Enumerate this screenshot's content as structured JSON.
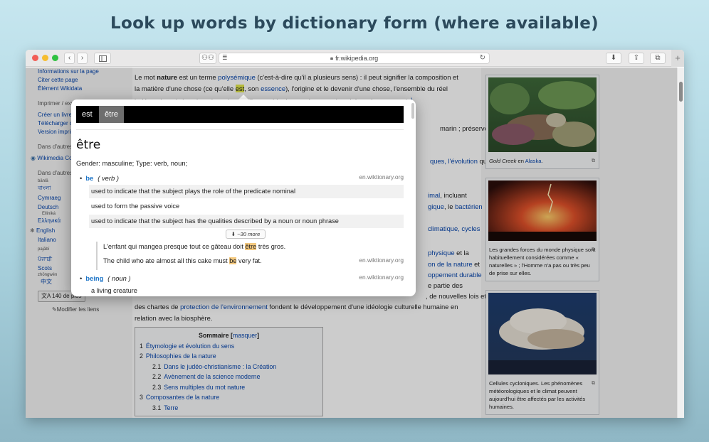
{
  "headline": "Look up words by dictionary form (where available)",
  "browser": {
    "url": "fr.wikipedia.org",
    "new_tab_symbol": "+"
  },
  "sidebar": {
    "items": [
      {
        "kind": "link",
        "text": "Informations sur la page"
      },
      {
        "kind": "link",
        "text": "Citer cette page"
      },
      {
        "kind": "link",
        "text": "Élément Wikidata"
      },
      {
        "kind": "head",
        "text": "Imprimer / exporter"
      },
      {
        "kind": "link",
        "text": "Créer un livre"
      },
      {
        "kind": "link",
        "text": "Télécharger comme PDF"
      },
      {
        "kind": "link",
        "text": "Version imprimable"
      },
      {
        "kind": "head",
        "text": "Dans d'autres projets"
      },
      {
        "kind": "link",
        "text": "Wikimedia Commons"
      },
      {
        "kind": "head",
        "text": "Dans d'autres langues"
      }
    ],
    "langs": [
      {
        "small": "bānlā",
        "text": "বাংলা"
      },
      {
        "small": "",
        "text": "Cymraeg"
      },
      {
        "small": "",
        "text": "Deutsch"
      },
      {
        "small": "Elliniká",
        "text": "Ελληνικά"
      },
      {
        "small": "",
        "text": "English"
      },
      {
        "small": "",
        "text": "Italiano"
      },
      {
        "small": "pajābī",
        "text": "ਪੰਜਾਬੀ"
      },
      {
        "small": "",
        "text": "Scots"
      },
      {
        "small": "zhōngwén",
        "text": "中文"
      }
    ],
    "more_langs": "140 de plus",
    "edit_links": "Modifier les liens"
  },
  "article": {
    "p1_a": "Le mot ",
    "p1_nature": "nature",
    "p1_b": " est un terme ",
    "p1_polysemique": "polysémique",
    "p1_c": " (c'est-à-dire qu'il a plusieurs sens) : il peut signifier la composition et",
    "p1_d": "la matière d'une chose (ce qu'elle ",
    "p1_est": "est",
    "p1_e": ", son ",
    "p1_essence": "essence",
    "p1_f": "), l'origine et le devenir d'une chose, l'ensemble du réel",
    "p1_g": "indépendant de la culture humaine, ou l'ensemble des systèmes et des phénomènes naturels",
    "frag1": "marin ; préservés",
    "frag2_a": "ques, l'",
    "frag2_b": "évolution",
    "frag2_c": " qui",
    "frag3_a": "imal",
    "frag3_b": ", incluant",
    "frag4_a": "gique",
    "frag4_b": ", le ",
    "frag4_c": "bactérien",
    "frag5": "climatique, cycles",
    "frag6_a": "physique",
    "frag6_b": " et la",
    "frag7_a": "on de la nature",
    "frag7_b": " et",
    "frag8": "oppement durable",
    "frag9": "e partie des",
    "p2_a": ", de nouvelles lois et",
    "p2_b": "des chartes de ",
    "p2_c": "protection de l'environnement",
    "p2_d": " fondent le développement d'une idéologie culturelle humaine en",
    "p2_e": "relation avec la biosphère."
  },
  "toc": {
    "title": "Sommaire",
    "hide": "masquer",
    "items": [
      {
        "num": "1",
        "text": "Étymologie et évolution du sens",
        "level": 1
      },
      {
        "num": "2",
        "text": "Philosophies de la nature",
        "level": 1
      },
      {
        "num": "2.1",
        "text": "Dans le judéo-christianisme : la Création",
        "level": 2
      },
      {
        "num": "2.2",
        "text": "Avènement de la science moderne",
        "level": 2
      },
      {
        "num": "2.3",
        "text": "Sens multiples du mot nature",
        "level": 2
      },
      {
        "num": "3",
        "text": "Composantes de la nature",
        "level": 1
      },
      {
        "num": "3.1",
        "text": "Terre",
        "level": 2
      }
    ]
  },
  "figures": [
    {
      "caption_a": "Gold Creek",
      "caption_b": " en ",
      "caption_c": "Alaska",
      "caption_d": "."
    },
    {
      "caption": "Les grandes forces du monde physique sont habituellement considérées comme « naturelles » ; l'Homme n'a pas ou très peu de prise sur elles."
    },
    {
      "caption": "Cellules cycloniques. Les phénomènes météorologiques et le climat peuvent aujourd'hui être affectés par les activités humaines."
    }
  ],
  "popup": {
    "tabs": [
      "est",
      "être"
    ],
    "headword": "être",
    "gender_line": "Gender: masculine; Type: verb, noun;",
    "senses": [
      {
        "word": "be",
        "pos": "( verb )",
        "source": "en.wiktionary.org",
        "definitions": [
          "used to indicate that the subject plays the role of the predicate nominal",
          "used to form the passive voice",
          "used to indicate that the subject has the qualities described by a noun or noun phrase"
        ],
        "more": "~30 more",
        "example_fr_a": "L'enfant qui mangea presque tout ce gâteau doit ",
        "example_fr_hl": "être",
        "example_fr_b": " très gros.",
        "example_en_a": "The child who ate almost all this cake must ",
        "example_en_hl": "be",
        "example_en_b": " very fat.",
        "example_source": "en.wiktionary.org"
      },
      {
        "word": "being",
        "pos": "( noun )",
        "source": "en.wiktionary.org",
        "definitions": [
          "a living creature"
        ]
      }
    ]
  },
  "colors": {
    "link": "#0645ad",
    "popup_word": "#1a73c7",
    "highlight": "#e3e84b",
    "example_highlight": "#f4c97f"
  }
}
